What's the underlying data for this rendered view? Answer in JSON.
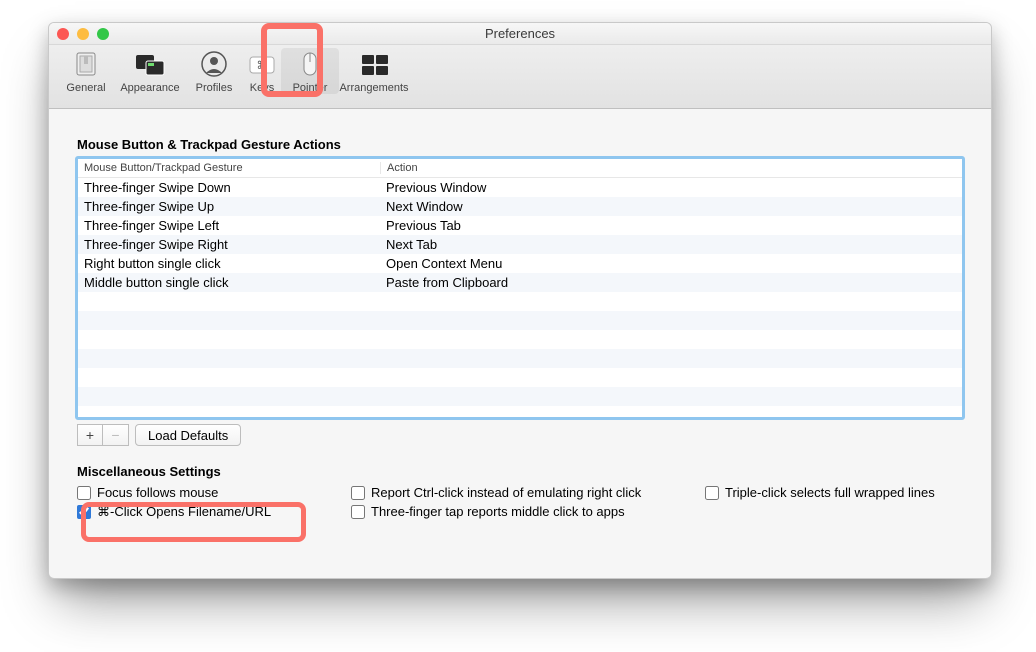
{
  "window": {
    "title": "Preferences"
  },
  "toolbar": {
    "items": [
      {
        "id": "general",
        "label": "General"
      },
      {
        "id": "appearance",
        "label": "Appearance"
      },
      {
        "id": "profiles",
        "label": "Profiles"
      },
      {
        "id": "keys",
        "label": "Keys"
      },
      {
        "id": "pointer",
        "label": "Pointer"
      },
      {
        "id": "arrangements",
        "label": "Arrangements"
      }
    ],
    "selected": "pointer"
  },
  "gestures": {
    "section_title": "Mouse Button & Trackpad Gesture Actions",
    "headers": {
      "col1": "Mouse Button/Trackpad Gesture",
      "col2": "Action"
    },
    "rows": [
      {
        "gesture": "Three-finger Swipe Down",
        "action": "Previous Window"
      },
      {
        "gesture": "Three-finger Swipe Up",
        "action": "Next Window"
      },
      {
        "gesture": "Three-finger Swipe Left",
        "action": "Previous Tab"
      },
      {
        "gesture": "Three-finger Swipe Right",
        "action": "Next Tab"
      },
      {
        "gesture": "Right button single click",
        "action": "Open Context Menu"
      },
      {
        "gesture": "Middle button single click",
        "action": "Paste from Clipboard"
      }
    ],
    "empty_rows": 6,
    "buttons": {
      "add": "+",
      "remove": "−",
      "load_defaults": "Load Defaults"
    }
  },
  "misc": {
    "section_title": "Miscellaneous Settings",
    "col1": [
      {
        "id": "focus-follows-mouse",
        "label": "Focus follows mouse",
        "checked": false
      },
      {
        "id": "cmd-click-opens",
        "label": "⌘-Click Opens Filename/URL",
        "checked": true
      }
    ],
    "col2": [
      {
        "id": "report-ctrl-click",
        "label": "Report Ctrl-click instead of emulating right click",
        "checked": false
      },
      {
        "id": "three-finger-tap",
        "label": "Three-finger tap reports middle click to apps",
        "checked": false
      }
    ],
    "col3": [
      {
        "id": "triple-click-wrapped",
        "label": "Triple-click selects full wrapped lines",
        "checked": false
      }
    ]
  }
}
